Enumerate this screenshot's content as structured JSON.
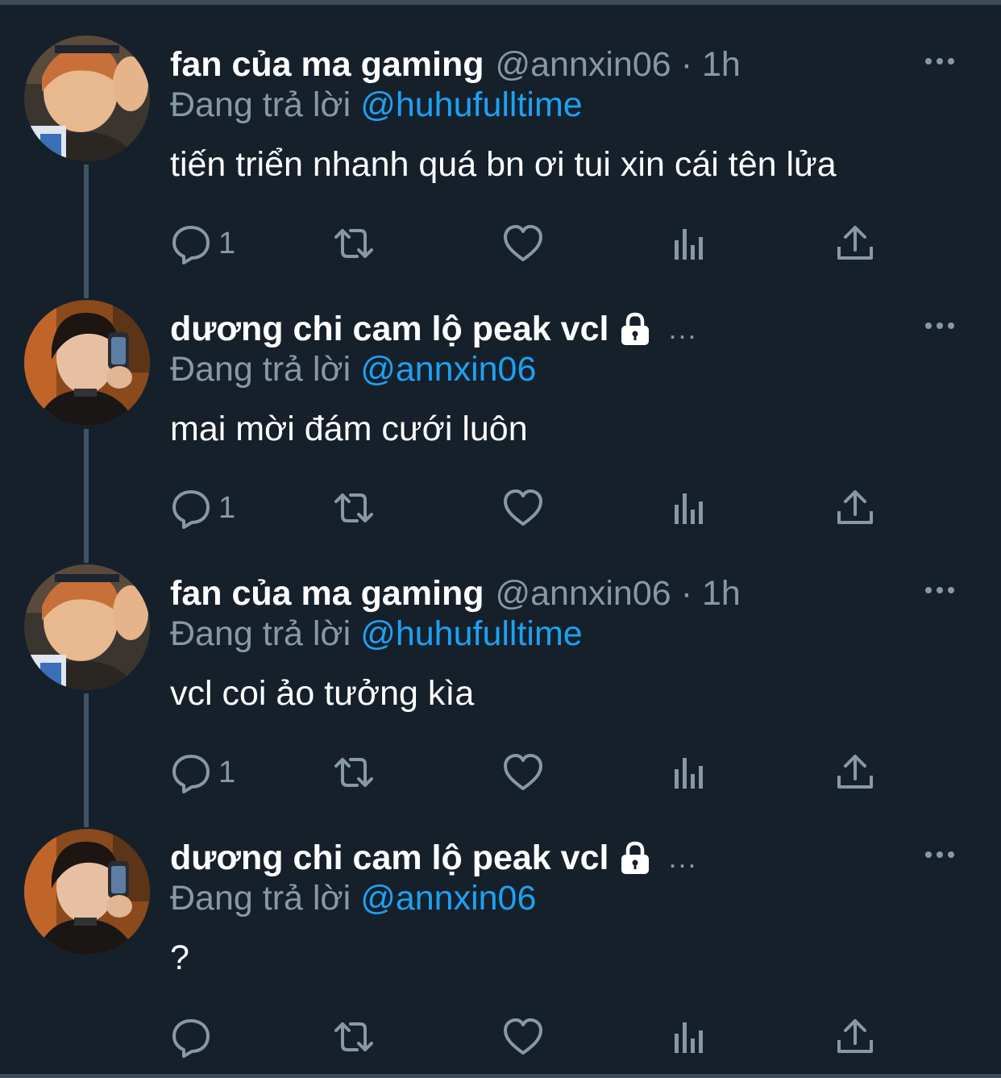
{
  "thread": {
    "tweets": [
      {
        "display_name": "fan của ma gaming",
        "handle": "@annxin06",
        "separator": "·",
        "time": "1h",
        "verified_lock": false,
        "truncated": false,
        "reply_prefix": "Đang trả lời",
        "reply_to": "@huhufulltime",
        "text": "tiến triển nhanh quá bn ơi tui xin cái tên lửa",
        "reply_count": "1",
        "avatar": "avatar-orange-hair"
      },
      {
        "display_name": "dương chi cam lộ peak vcl",
        "handle": "",
        "separator": "",
        "time": "",
        "verified_lock": true,
        "truncated": true,
        "truncation": "...",
        "reply_prefix": "Đang trả lời",
        "reply_to": "@annxin06",
        "text": "mai mời đám cưới luôn",
        "reply_count": "1",
        "avatar": "avatar-dark-hair-phone"
      },
      {
        "display_name": "fan của ma gaming",
        "handle": "@annxin06",
        "separator": "·",
        "time": "1h",
        "verified_lock": false,
        "truncated": false,
        "reply_prefix": "Đang trả lời",
        "reply_to": "@huhufulltime",
        "text": "vcl coi ảo tưởng kìa",
        "reply_count": "1",
        "avatar": "avatar-orange-hair"
      },
      {
        "display_name": "dương chi cam lộ peak vcl",
        "handle": "",
        "separator": "",
        "time": "",
        "verified_lock": true,
        "truncated": true,
        "truncation": "...",
        "reply_prefix": "Đang trả lời",
        "reply_to": "@annxin06",
        "text": "?",
        "reply_count": "",
        "avatar": "avatar-dark-hair-phone"
      }
    ]
  },
  "icons": {
    "reply": "reply-icon",
    "retweet": "retweet-icon",
    "like": "heart-icon",
    "stats": "analytics-icon",
    "share": "share-icon",
    "more": "more-icon",
    "lock": "lock-icon"
  },
  "colors": {
    "background": "#15202b",
    "accent": "#1da1f2",
    "muted": "#8899a6",
    "thread_line": "#3d5466"
  }
}
